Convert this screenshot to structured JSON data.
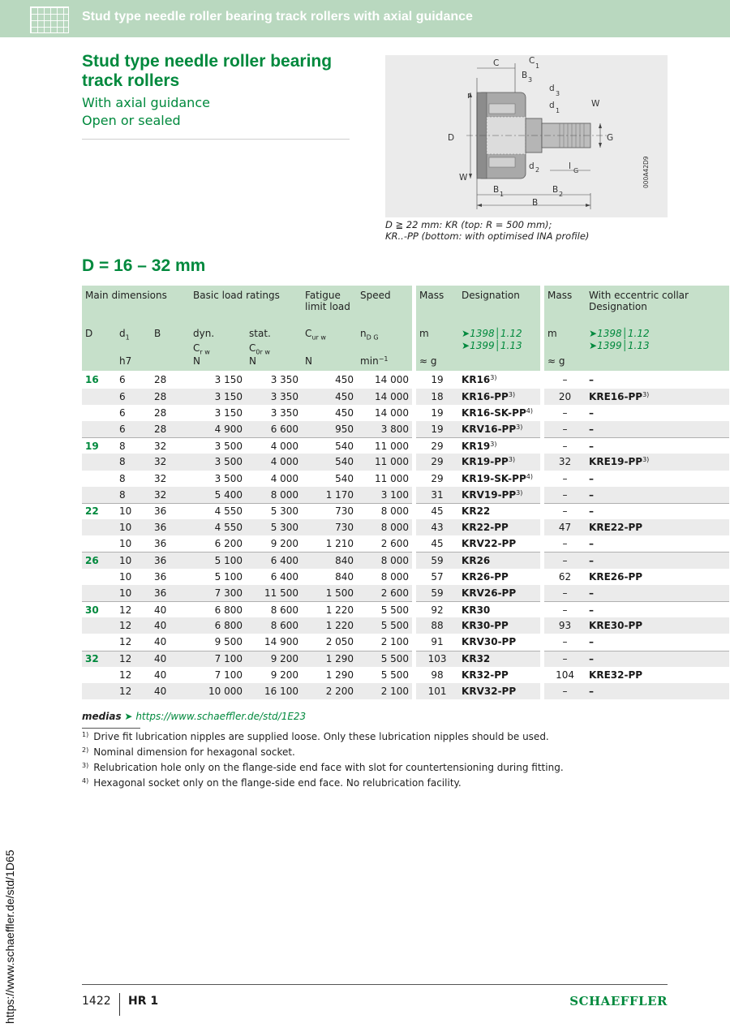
{
  "header": {
    "title": "Stud type needle roller bearing track rollers with axial guidance"
  },
  "product": {
    "title": "Stud type needle roller bearing track rollers",
    "subtitle_1": "With axial guidance",
    "subtitle_2": "Open or sealed"
  },
  "drawing": {
    "labels": [
      "C",
      "C",
      "1",
      "B",
      "3",
      "r",
      "d",
      "3",
      "d",
      "1",
      "W",
      "D",
      "G",
      "W",
      "d",
      "2",
      "l",
      "G",
      "B",
      "1",
      "B",
      "2",
      "B"
    ],
    "code": "000A42D9",
    "caption_1": "D ≧ 22 mm: KR (top: R = 500 mm);",
    "caption_2": "KR..-PP (bottom: with optimised INA profile)"
  },
  "range_title": "D = 16 – 32 mm",
  "table": {
    "head": {
      "main_dimensions": "Main dimensions",
      "basic_load_ratings": "Basic load ratings",
      "fatigue_limit_load": "Fatigue limit load",
      "speed": "Speed",
      "mass": "Mass",
      "designation": "Designation",
      "mass_2": "Mass",
      "eccentric_designation": "With eccentric collar Designation",
      "D": "D",
      "d1": "d",
      "d1_sub": "1",
      "B": "B",
      "dyn": "dyn.",
      "stat": "stat.",
      "Crw": "C",
      "Crw_sub": "r w",
      "C0rw": "C",
      "C0rw_sub": "0r w",
      "Curw": "C",
      "Curw_sub": "ur w",
      "nDG": "n",
      "nDG_sub": "D G",
      "m": "m",
      "refs_1": "➤1398│1.12",
      "refs_2": "➤1399│1.13",
      "m_2": "m",
      "refs_3": "➤1398│1.12",
      "refs_4": "➤1399│1.13",
      "unit_h7": "h7",
      "unit_N1": "N",
      "unit_N2": "N",
      "unit_N3": "N",
      "unit_min": "min",
      "unit_min_sup": "−1",
      "unit_g1": "≈ g",
      "unit_g2": "≈ g"
    },
    "rows": [
      {
        "D": "16",
        "d1": "6",
        "B": "28",
        "Cr": "3 150",
        "C0r": "3 350",
        "Cur": "450",
        "n": "14 000",
        "m": "19",
        "des": "KR16",
        "des_fn": "3)",
        "m2": "–",
        "ecc": "–",
        "ecc_fn": ""
      },
      {
        "D": "",
        "d1": "6",
        "B": "28",
        "Cr": "3 150",
        "C0r": "3 350",
        "Cur": "450",
        "n": "14 000",
        "m": "18",
        "des": "KR16-PP",
        "des_fn": "3)",
        "m2": "20",
        "ecc": "KRE16-PP",
        "ecc_fn": "3)"
      },
      {
        "D": "",
        "d1": "6",
        "B": "28",
        "Cr": "3 150",
        "C0r": "3 350",
        "Cur": "450",
        "n": "14 000",
        "m": "19",
        "des": "KR16-SK-PP",
        "des_fn": "4)",
        "m2": "–",
        "ecc": "–",
        "ecc_fn": ""
      },
      {
        "D": "",
        "d1": "6",
        "B": "28",
        "Cr": "4 900",
        "C0r": "6 600",
        "Cur": "950",
        "n": "3 800",
        "m": "19",
        "des": "KRV16-PP",
        "des_fn": "3)",
        "m2": "–",
        "ecc": "–",
        "ecc_fn": ""
      },
      {
        "D": "19",
        "d1": "8",
        "B": "32",
        "Cr": "3 500",
        "C0r": "4 000",
        "Cur": "540",
        "n": "11 000",
        "m": "29",
        "des": "KR19",
        "des_fn": "3)",
        "m2": "–",
        "ecc": "–",
        "ecc_fn": ""
      },
      {
        "D": "",
        "d1": "8",
        "B": "32",
        "Cr": "3 500",
        "C0r": "4 000",
        "Cur": "540",
        "n": "11 000",
        "m": "29",
        "des": "KR19-PP",
        "des_fn": "3)",
        "m2": "32",
        "ecc": "KRE19-PP",
        "ecc_fn": "3)"
      },
      {
        "D": "",
        "d1": "8",
        "B": "32",
        "Cr": "3 500",
        "C0r": "4 000",
        "Cur": "540",
        "n": "11 000",
        "m": "29",
        "des": "KR19-SK-PP",
        "des_fn": "4)",
        "m2": "–",
        "ecc": "–",
        "ecc_fn": ""
      },
      {
        "D": "",
        "d1": "8",
        "B": "32",
        "Cr": "5 400",
        "C0r": "8 000",
        "Cur": "1 170",
        "n": "3 100",
        "m": "31",
        "des": "KRV19-PP",
        "des_fn": "3)",
        "m2": "–",
        "ecc": "–",
        "ecc_fn": ""
      },
      {
        "D": "22",
        "d1": "10",
        "B": "36",
        "Cr": "4 550",
        "C0r": "5 300",
        "Cur": "730",
        "n": "8 000",
        "m": "45",
        "des": "KR22",
        "des_fn": "",
        "m2": "–",
        "ecc": "–",
        "ecc_fn": ""
      },
      {
        "D": "",
        "d1": "10",
        "B": "36",
        "Cr": "4 550",
        "C0r": "5 300",
        "Cur": "730",
        "n": "8 000",
        "m": "43",
        "des": "KR22-PP",
        "des_fn": "",
        "m2": "47",
        "ecc": "KRE22-PP",
        "ecc_fn": ""
      },
      {
        "D": "",
        "d1": "10",
        "B": "36",
        "Cr": "6 200",
        "C0r": "9 200",
        "Cur": "1 210",
        "n": "2 600",
        "m": "45",
        "des": "KRV22-PP",
        "des_fn": "",
        "m2": "–",
        "ecc": "–",
        "ecc_fn": ""
      },
      {
        "D": "26",
        "d1": "10",
        "B": "36",
        "Cr": "5 100",
        "C0r": "6 400",
        "Cur": "840",
        "n": "8 000",
        "m": "59",
        "des": "KR26",
        "des_fn": "",
        "m2": "–",
        "ecc": "–",
        "ecc_fn": ""
      },
      {
        "D": "",
        "d1": "10",
        "B": "36",
        "Cr": "5 100",
        "C0r": "6 400",
        "Cur": "840",
        "n": "8 000",
        "m": "57",
        "des": "KR26-PP",
        "des_fn": "",
        "m2": "62",
        "ecc": "KRE26-PP",
        "ecc_fn": ""
      },
      {
        "D": "",
        "d1": "10",
        "B": "36",
        "Cr": "7 300",
        "C0r": "11 500",
        "Cur": "1 500",
        "n": "2 600",
        "m": "59",
        "des": "KRV26-PP",
        "des_fn": "",
        "m2": "–",
        "ecc": "–",
        "ecc_fn": ""
      },
      {
        "D": "30",
        "d1": "12",
        "B": "40",
        "Cr": "6 800",
        "C0r": "8 600",
        "Cur": "1 220",
        "n": "5 500",
        "m": "92",
        "des": "KR30",
        "des_fn": "",
        "m2": "–",
        "ecc": "–",
        "ecc_fn": ""
      },
      {
        "D": "",
        "d1": "12",
        "B": "40",
        "Cr": "6 800",
        "C0r": "8 600",
        "Cur": "1 220",
        "n": "5 500",
        "m": "88",
        "des": "KR30-PP",
        "des_fn": "",
        "m2": "93",
        "ecc": "KRE30-PP",
        "ecc_fn": ""
      },
      {
        "D": "",
        "d1": "12",
        "B": "40",
        "Cr": "9 500",
        "C0r": "14 900",
        "Cur": "2 050",
        "n": "2 100",
        "m": "91",
        "des": "KRV30-PP",
        "des_fn": "",
        "m2": "–",
        "ecc": "–",
        "ecc_fn": ""
      },
      {
        "D": "32",
        "d1": "12",
        "B": "40",
        "Cr": "7 100",
        "C0r": "9 200",
        "Cur": "1 290",
        "n": "5 500",
        "m": "103",
        "des": "KR32",
        "des_fn": "",
        "m2": "–",
        "ecc": "–",
        "ecc_fn": ""
      },
      {
        "D": "",
        "d1": "12",
        "B": "40",
        "Cr": "7 100",
        "C0r": "9 200",
        "Cur": "1 290",
        "n": "5 500",
        "m": "98",
        "des": "KR32-PP",
        "des_fn": "",
        "m2": "104",
        "ecc": "KRE32-PP",
        "ecc_fn": ""
      },
      {
        "D": "",
        "d1": "12",
        "B": "40",
        "Cr": "10 000",
        "C0r": "16 100",
        "Cur": "2 200",
        "n": "2 100",
        "m": "101",
        "des": "KRV32-PP",
        "des_fn": "",
        "m2": "–",
        "ecc": "–",
        "ecc_fn": ""
      }
    ]
  },
  "media": {
    "label": "medias",
    "arrow": "➤",
    "link": "https://www.schaeffler.de/std/1E23"
  },
  "footnotes": [
    {
      "mark": "1)",
      "text": "Drive fit lubrication nipples are supplied loose. Only these lubrication nipples should be used."
    },
    {
      "mark": "2)",
      "text": "Nominal dimension for hexagonal socket."
    },
    {
      "mark": "3)",
      "text": "Relubrication hole only on the flange-side end face with slot for countertensioning during fitting."
    },
    {
      "mark": "4)",
      "text": "Hexagonal socket only on the flange-side end face. No relubrication facility."
    }
  ],
  "side_url": "https://www.schaeffler.de/std/1D65",
  "footer": {
    "page": "1422",
    "catalog": "HR 1",
    "brand": "SCHAEFFLER"
  },
  "colors": {
    "accent": "#00893d",
    "header": "#b9d8bf",
    "table_head": "#c6e0ca",
    "stripe": "#ebebeb"
  }
}
